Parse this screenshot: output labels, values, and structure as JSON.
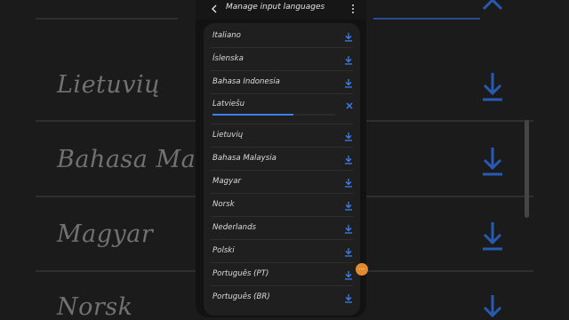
{
  "header": {
    "title": "Manage input languages",
    "back_icon": "arrow-left-icon",
    "more_icon": "more-vertical-icon"
  },
  "languages": [
    {
      "label": "Italiano",
      "icon": "download-icon"
    },
    {
      "label": "Íslenska",
      "icon": "download-icon"
    },
    {
      "label": "Bahasa Indonesia",
      "icon": "download-icon"
    },
    {
      "label": "Latviešu",
      "icon": "close-icon",
      "downloading": true,
      "progress": 0.66
    },
    {
      "label": "Lietuvių",
      "icon": "download-icon"
    },
    {
      "label": "Bahasa Malaysia",
      "icon": "download-icon"
    },
    {
      "label": "Magyar",
      "icon": "download-icon"
    },
    {
      "label": "Norsk",
      "icon": "download-icon"
    },
    {
      "label": "Nederlands",
      "icon": "download-icon"
    },
    {
      "label": "Polski",
      "icon": "download-icon"
    },
    {
      "label": "Português (PT)",
      "icon": "download-icon"
    },
    {
      "label": "Português (BR)",
      "icon": "download-icon"
    }
  ],
  "background_zoom": {
    "items": [
      "Lietuvių",
      "Bahasa Malaysia",
      "Magyar",
      "Norsk"
    ]
  },
  "colors": {
    "accent": "#3c7ff0",
    "panel": "#1f1f1f",
    "text": "#dcdcdc",
    "orange": "#e08a2e"
  },
  "overlay": {
    "orange_dot_text": "···"
  }
}
